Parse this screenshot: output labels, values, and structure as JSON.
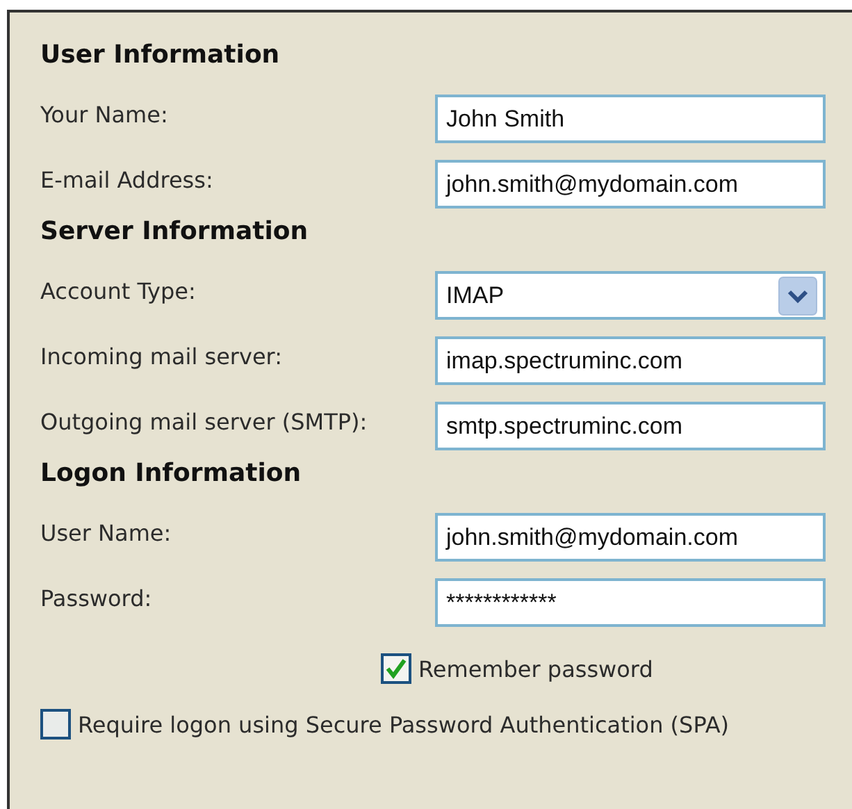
{
  "sections": [
    {
      "heading": "User Information",
      "items": [
        {
          "kind": "field",
          "label": "Your Name:",
          "value": "John Smith"
        },
        {
          "kind": "field",
          "label": "E-mail Address:",
          "value": "john.smith@mydomain.com"
        }
      ]
    },
    {
      "heading": "Server Information",
      "items": [
        {
          "kind": "select",
          "label": "Account Type:",
          "value": "IMAP"
        },
        {
          "kind": "field",
          "label": "Incoming mail server:",
          "value": "imap.spectruminc.com"
        },
        {
          "kind": "field",
          "label": "Outgoing mail server (SMTP):",
          "value": "smtp.spectruminc.com"
        }
      ]
    },
    {
      "heading": "Logon Information",
      "items": [
        {
          "kind": "field",
          "label": "User Name:",
          "value": "john.smith@mydomain.com"
        },
        {
          "kind": "field",
          "label": "Password:",
          "value": "************"
        },
        {
          "kind": "checkbox",
          "label": "Remember password",
          "checked": true
        }
      ]
    }
  ],
  "spa_option": {
    "label": "Require logon using Secure Password Authentication (SPA)",
    "checked": false
  }
}
